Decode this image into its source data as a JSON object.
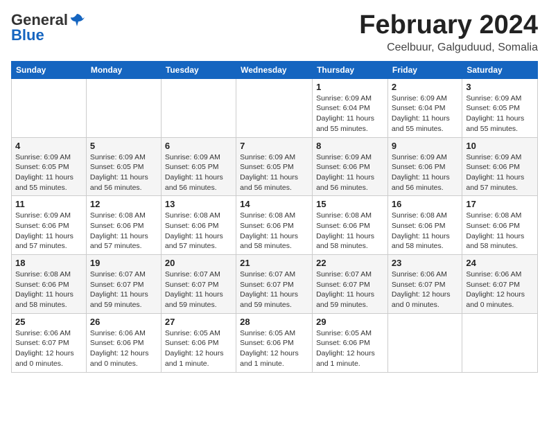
{
  "logo": {
    "general": "General",
    "blue": "Blue"
  },
  "header": {
    "month": "February 2024",
    "location": "Ceelbuur, Galguduud, Somalia"
  },
  "weekdays": [
    "Sunday",
    "Monday",
    "Tuesday",
    "Wednesday",
    "Thursday",
    "Friday",
    "Saturday"
  ],
  "weeks": [
    [
      {
        "day": "",
        "info": ""
      },
      {
        "day": "",
        "info": ""
      },
      {
        "day": "",
        "info": ""
      },
      {
        "day": "",
        "info": ""
      },
      {
        "day": "1",
        "info": "Sunrise: 6:09 AM\nSunset: 6:04 PM\nDaylight: 11 hours and 55 minutes."
      },
      {
        "day": "2",
        "info": "Sunrise: 6:09 AM\nSunset: 6:04 PM\nDaylight: 11 hours and 55 minutes."
      },
      {
        "day": "3",
        "info": "Sunrise: 6:09 AM\nSunset: 6:05 PM\nDaylight: 11 hours and 55 minutes."
      }
    ],
    [
      {
        "day": "4",
        "info": "Sunrise: 6:09 AM\nSunset: 6:05 PM\nDaylight: 11 hours and 55 minutes."
      },
      {
        "day": "5",
        "info": "Sunrise: 6:09 AM\nSunset: 6:05 PM\nDaylight: 11 hours and 56 minutes."
      },
      {
        "day": "6",
        "info": "Sunrise: 6:09 AM\nSunset: 6:05 PM\nDaylight: 11 hours and 56 minutes."
      },
      {
        "day": "7",
        "info": "Sunrise: 6:09 AM\nSunset: 6:05 PM\nDaylight: 11 hours and 56 minutes."
      },
      {
        "day": "8",
        "info": "Sunrise: 6:09 AM\nSunset: 6:06 PM\nDaylight: 11 hours and 56 minutes."
      },
      {
        "day": "9",
        "info": "Sunrise: 6:09 AM\nSunset: 6:06 PM\nDaylight: 11 hours and 56 minutes."
      },
      {
        "day": "10",
        "info": "Sunrise: 6:09 AM\nSunset: 6:06 PM\nDaylight: 11 hours and 57 minutes."
      }
    ],
    [
      {
        "day": "11",
        "info": "Sunrise: 6:09 AM\nSunset: 6:06 PM\nDaylight: 11 hours and 57 minutes."
      },
      {
        "day": "12",
        "info": "Sunrise: 6:08 AM\nSunset: 6:06 PM\nDaylight: 11 hours and 57 minutes."
      },
      {
        "day": "13",
        "info": "Sunrise: 6:08 AM\nSunset: 6:06 PM\nDaylight: 11 hours and 57 minutes."
      },
      {
        "day": "14",
        "info": "Sunrise: 6:08 AM\nSunset: 6:06 PM\nDaylight: 11 hours and 58 minutes."
      },
      {
        "day": "15",
        "info": "Sunrise: 6:08 AM\nSunset: 6:06 PM\nDaylight: 11 hours and 58 minutes."
      },
      {
        "day": "16",
        "info": "Sunrise: 6:08 AM\nSunset: 6:06 PM\nDaylight: 11 hours and 58 minutes."
      },
      {
        "day": "17",
        "info": "Sunrise: 6:08 AM\nSunset: 6:06 PM\nDaylight: 11 hours and 58 minutes."
      }
    ],
    [
      {
        "day": "18",
        "info": "Sunrise: 6:08 AM\nSunset: 6:06 PM\nDaylight: 11 hours and 58 minutes."
      },
      {
        "day": "19",
        "info": "Sunrise: 6:07 AM\nSunset: 6:07 PM\nDaylight: 11 hours and 59 minutes."
      },
      {
        "day": "20",
        "info": "Sunrise: 6:07 AM\nSunset: 6:07 PM\nDaylight: 11 hours and 59 minutes."
      },
      {
        "day": "21",
        "info": "Sunrise: 6:07 AM\nSunset: 6:07 PM\nDaylight: 11 hours and 59 minutes."
      },
      {
        "day": "22",
        "info": "Sunrise: 6:07 AM\nSunset: 6:07 PM\nDaylight: 11 hours and 59 minutes."
      },
      {
        "day": "23",
        "info": "Sunrise: 6:06 AM\nSunset: 6:07 PM\nDaylight: 12 hours and 0 minutes."
      },
      {
        "day": "24",
        "info": "Sunrise: 6:06 AM\nSunset: 6:07 PM\nDaylight: 12 hours and 0 minutes."
      }
    ],
    [
      {
        "day": "25",
        "info": "Sunrise: 6:06 AM\nSunset: 6:07 PM\nDaylight: 12 hours and 0 minutes."
      },
      {
        "day": "26",
        "info": "Sunrise: 6:06 AM\nSunset: 6:06 PM\nDaylight: 12 hours and 0 minutes."
      },
      {
        "day": "27",
        "info": "Sunrise: 6:05 AM\nSunset: 6:06 PM\nDaylight: 12 hours and 1 minute."
      },
      {
        "day": "28",
        "info": "Sunrise: 6:05 AM\nSunset: 6:06 PM\nDaylight: 12 hours and 1 minute."
      },
      {
        "day": "29",
        "info": "Sunrise: 6:05 AM\nSunset: 6:06 PM\nDaylight: 12 hours and 1 minute."
      },
      {
        "day": "",
        "info": ""
      },
      {
        "day": "",
        "info": ""
      }
    ]
  ]
}
